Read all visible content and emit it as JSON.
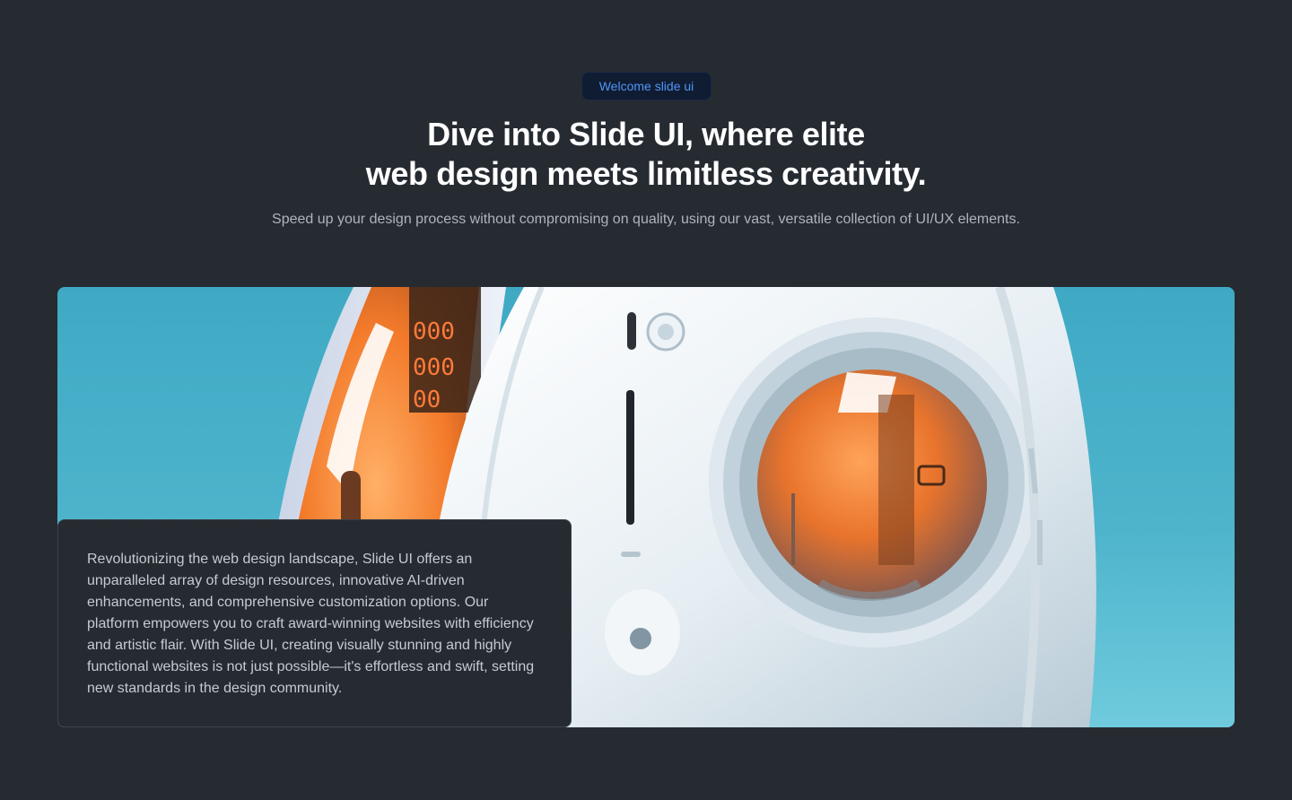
{
  "header": {
    "badge_label": "Welcome slide ui",
    "title_line1": "Dive into Slide UI, where elite",
    "title_line2": "web design meets limitless creativity.",
    "subtitle": "Speed up your design process without compromising on quality, using our vast, versatile collection of UI/UX elements."
  },
  "hero": {
    "image_icon": "robot-capsule-illustration",
    "background_color": "#4eb4cc",
    "accent_color": "#ff8a3d",
    "card_text": "Revolutionizing the web design landscape, Slide UI offers an unparalleled array of design resources, innovative AI-driven enhancements, and comprehensive customization options. Our platform empowers you to craft award-winning websites with efficiency and artistic flair. With Slide UI, creating visually stunning and highly functional websites is not just possible—it's effortless and swift, setting new standards in the design community."
  },
  "colors": {
    "page_background": "#252b31",
    "badge_text": "#4f96f5",
    "title_text": "#ffffff",
    "body_text": "#aeb4bb"
  }
}
